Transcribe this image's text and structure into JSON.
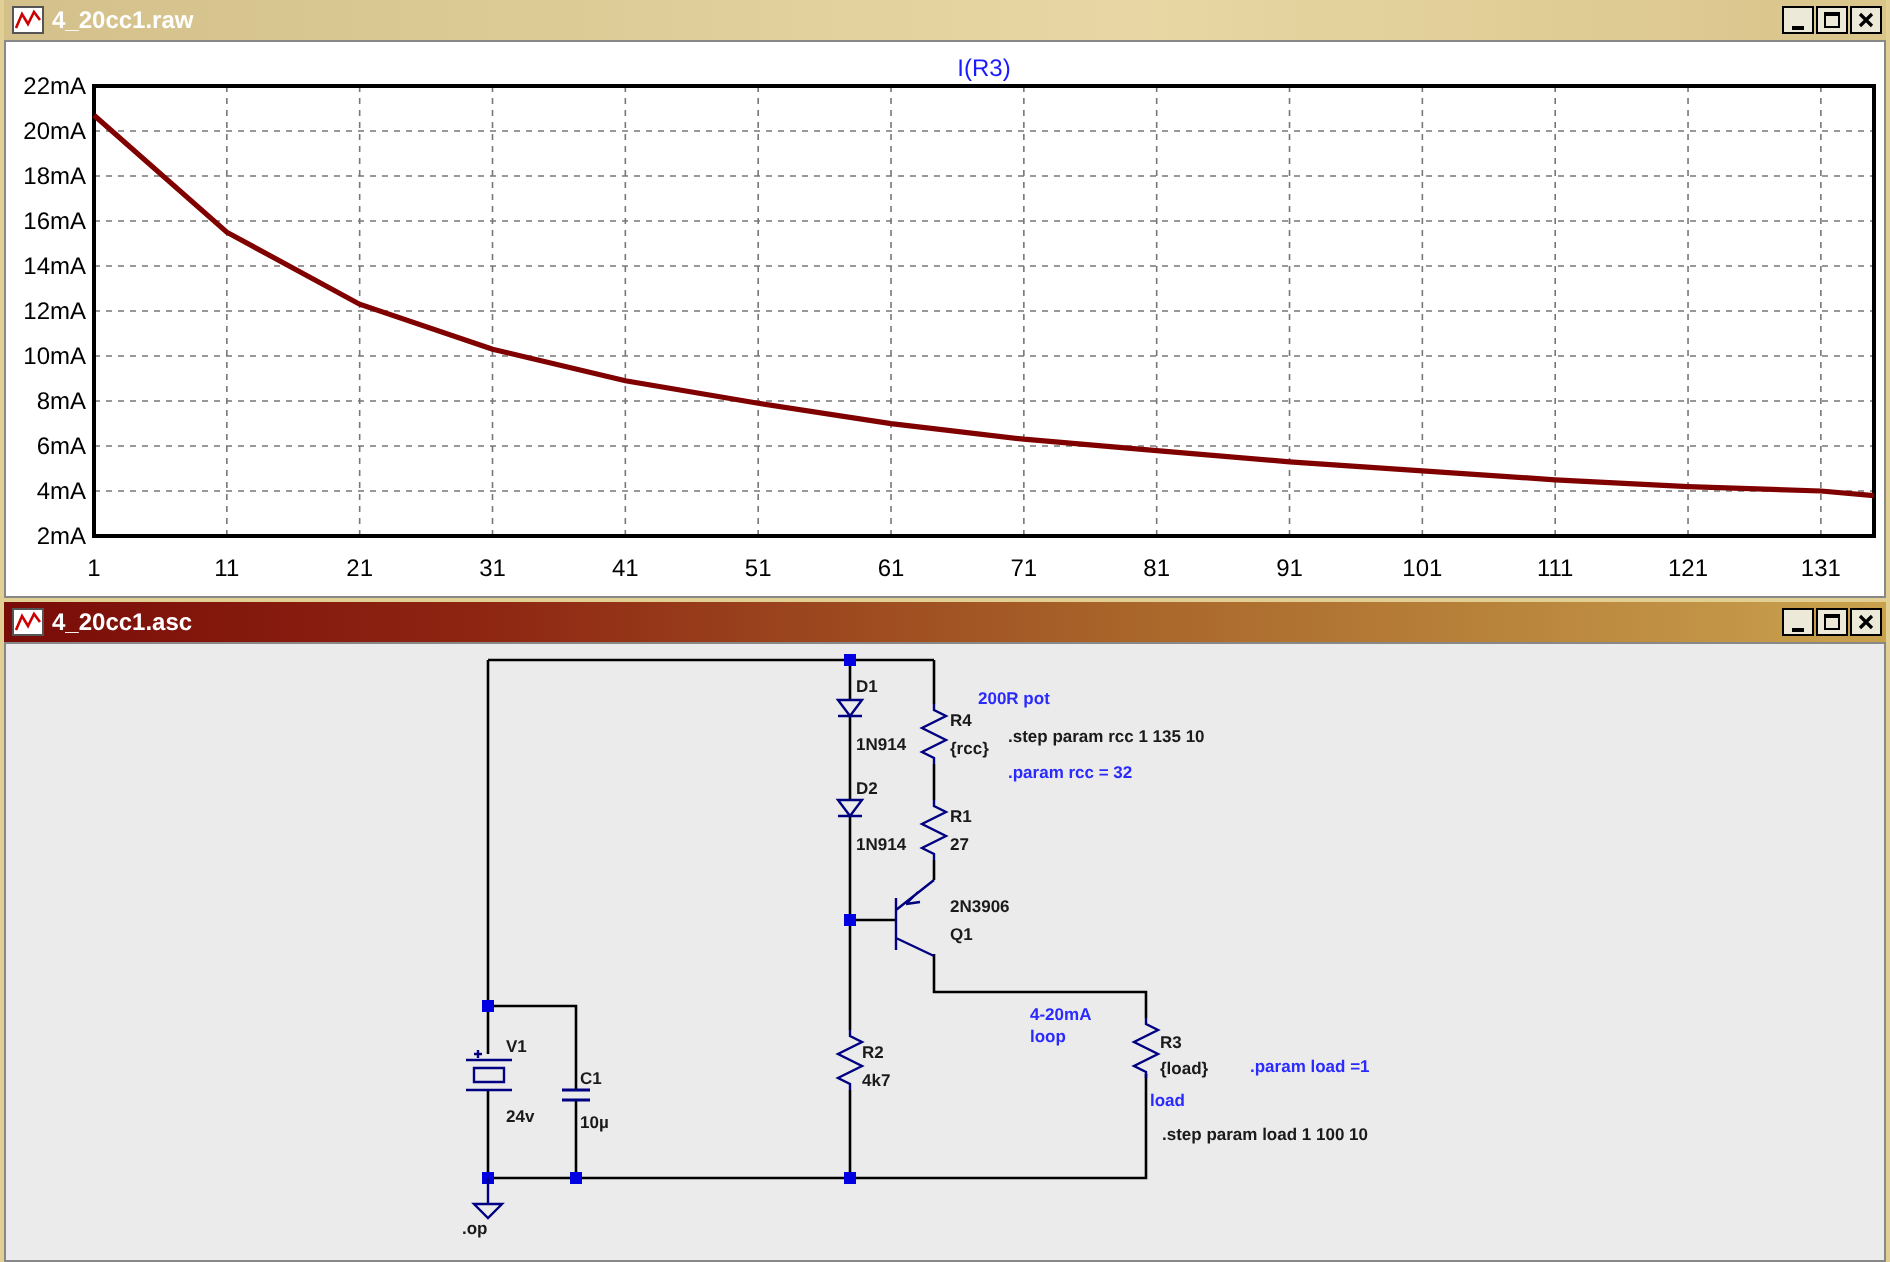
{
  "windows": [
    {
      "title": "4_20cc1.raw",
      "active": false,
      "kind": "plot"
    },
    {
      "title": "4_20cc1.asc",
      "active": true,
      "kind": "schematic"
    }
  ],
  "plot": {
    "chart_data": {
      "type": "line",
      "grid": true,
      "xlim": [
        1,
        135
      ],
      "ylim": [
        2,
        22
      ],
      "xticks": [
        1,
        11,
        21,
        31,
        41,
        51,
        61,
        71,
        81,
        91,
        101,
        111,
        121,
        131
      ],
      "yticks": [
        {
          "value": 2,
          "label": "2mA"
        },
        {
          "value": 4,
          "label": "4mA"
        },
        {
          "value": 6,
          "label": "6mA"
        },
        {
          "value": 8,
          "label": "8mA"
        },
        {
          "value": 10,
          "label": "10mA"
        },
        {
          "value": 12,
          "label": "12mA"
        },
        {
          "value": 14,
          "label": "14mA"
        },
        {
          "value": 16,
          "label": "16mA"
        },
        {
          "value": 18,
          "label": "18mA"
        },
        {
          "value": 20,
          "label": "20mA"
        },
        {
          "value": 22,
          "label": "22mA"
        }
      ],
      "x": [
        1,
        11,
        21,
        31,
        41,
        51,
        61,
        71,
        81,
        91,
        101,
        111,
        121,
        131,
        135
      ],
      "series": [
        {
          "name": "I(R3)",
          "color": "#800000",
          "values": [
            20.7,
            15.5,
            12.3,
            10.3,
            8.9,
            7.9,
            7.0,
            6.3,
            5.8,
            5.3,
            4.9,
            4.5,
            4.2,
            4.0,
            3.8
          ]
        }
      ]
    }
  },
  "schematic": {
    "labels": [
      {
        "text": "D1",
        "kind": "name"
      },
      {
        "text": "1N914",
        "kind": "value"
      },
      {
        "text": "D2",
        "kind": "name"
      },
      {
        "text": "1N914",
        "kind": "value"
      },
      {
        "text": "200R pot",
        "kind": "comment"
      },
      {
        "text": "R4",
        "kind": "name"
      },
      {
        "text": "{rcc}",
        "kind": "value"
      },
      {
        "text": ".step param rcc 1 135 10",
        "kind": "directive"
      },
      {
        "text": ".param rcc = 32",
        "kind": "comment"
      },
      {
        "text": "R1",
        "kind": "name"
      },
      {
        "text": "27",
        "kind": "value"
      },
      {
        "text": "2N3906",
        "kind": "value"
      },
      {
        "text": "Q1",
        "kind": "name"
      },
      {
        "text": "4-20mA",
        "kind": "comment"
      },
      {
        "text": "loop",
        "kind": "comment"
      },
      {
        "text": "R3",
        "kind": "name"
      },
      {
        "text": "{load}",
        "kind": "value"
      },
      {
        "text": ".param load =1",
        "kind": "comment"
      },
      {
        "text": "load",
        "kind": "comment"
      },
      {
        "text": ".step param load 1 100 10",
        "kind": "directive"
      },
      {
        "text": "V1",
        "kind": "name"
      },
      {
        "text": "24v",
        "kind": "value"
      },
      {
        "text": "C1",
        "kind": "name"
      },
      {
        "text": "10µ",
        "kind": "value"
      },
      {
        "text": "R2",
        "kind": "name"
      },
      {
        "text": "4k7",
        "kind": "value"
      },
      {
        "text": ".op",
        "kind": "value"
      }
    ]
  }
}
